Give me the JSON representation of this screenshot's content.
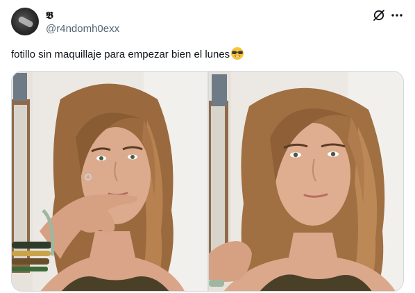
{
  "post": {
    "author_name": "𝕭",
    "author_handle": "@r4ndomh0exx",
    "text": "fotillo sin maquillaje para empezar bien el lunes",
    "emoji": "nerd-face-with-sunglasses",
    "images": [
      {
        "alt": ""
      },
      {
        "alt": ""
      }
    ]
  },
  "icons": {
    "grok": "grok-icon",
    "more": "more-icon"
  },
  "colors": {
    "text_primary": "#0f1419",
    "text_secondary": "#536471",
    "border": "#cfd9de",
    "hair": "#9a6a3e",
    "skin": "#d9a487",
    "top": "#4a4028"
  }
}
